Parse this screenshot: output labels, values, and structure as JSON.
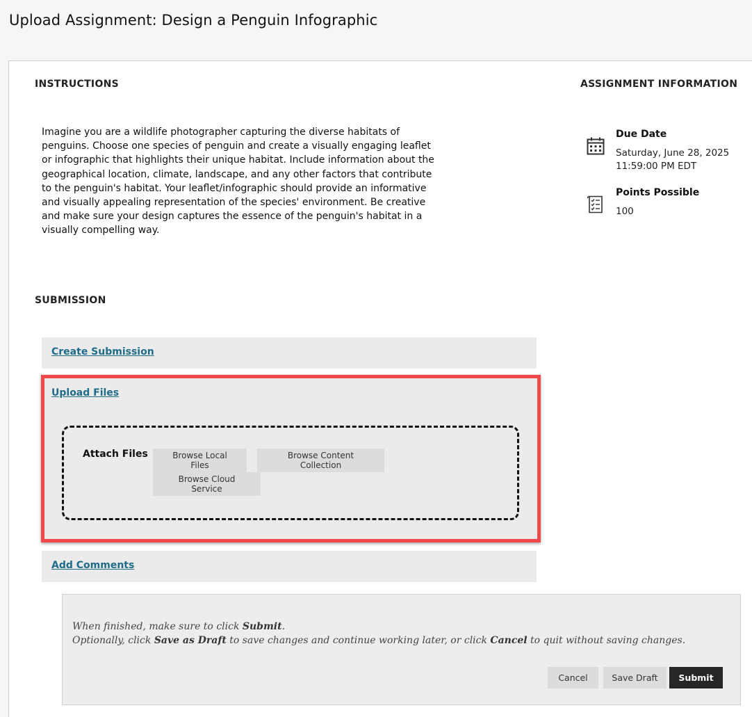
{
  "page": {
    "title": "Upload Assignment: Design a Penguin Infographic"
  },
  "instructions": {
    "heading": "INSTRUCTIONS",
    "text": "Imagine you are a wildlife photographer capturing the diverse habitats of penguins. Choose one species of penguin and create a visually engaging leaflet or infographic that highlights their unique habitat. Include information about the geographical location, climate, landscape, and any other factors that contribute to the penguin's habitat. Your leaflet/infographic should provide an informative and visually appealing representation of the species' environment. Be creative and make sure your design captures the essence of the penguin's habitat in a visually compelling way."
  },
  "assignment_info": {
    "heading": "ASSIGNMENT INFORMATION",
    "due_date": {
      "label": "Due Date",
      "date": "Saturday, June 28, 2025",
      "time": "11:59:00 PM EDT",
      "icon": "calendar-icon"
    },
    "points": {
      "label": "Points Possible",
      "value": "100",
      "icon": "checklist-icon"
    }
  },
  "submission": {
    "heading": "SUBMISSION",
    "create_label": "Create Submission",
    "upload_label": "Upload Files",
    "attach_label": "Attach Files",
    "browse_local": "Browse Local Files",
    "browse_content": "Browse Content Collection",
    "browse_cloud": "Browse Cloud Service",
    "comments_label": "Add Comments",
    "highlight_color": "#f2484b"
  },
  "footer": {
    "line1_a": "When finished, make sure to click ",
    "line1_b": "Submit",
    "line1_c": ".",
    "line2_a": "Optionally, click ",
    "line2_b": "Save as Draft",
    "line2_c": " to save changes and continue working later, or click ",
    "line2_d": "Cancel",
    "line2_e": " to quit without saving changes.",
    "cancel": "Cancel",
    "save_draft": "Save Draft",
    "submit": "Submit"
  }
}
